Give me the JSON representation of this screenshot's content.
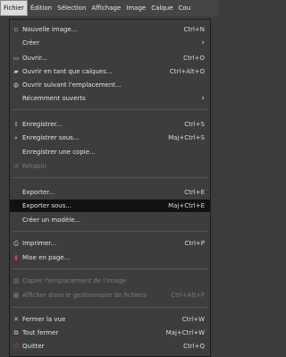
{
  "menubar": {
    "items": [
      "Fichier",
      "Édition",
      "Sélection",
      "Affichage",
      "Image",
      "Calque",
      "Cou"
    ]
  },
  "menu": {
    "items": [
      {
        "label": "Nouvelle image...",
        "shortcut": "Ctrl+N",
        "icon": "new-image-icon"
      },
      {
        "label": "Créer",
        "submenu": "›"
      },
      {
        "label": "Ouvrir...",
        "shortcut": "Ctrl+O",
        "icon": "open-icon"
      },
      {
        "label": "Ouvrir en tant que calques...",
        "shortcut": "Ctrl+Alt+O",
        "icon": "open-as-layers-icon"
      },
      {
        "label": "Ouvrir suivant l'emplacement...",
        "icon": "open-location-icon"
      },
      {
        "label": "Récemment ouverts",
        "submenu": "›"
      },
      {
        "label": "Enregistrer...",
        "shortcut": "Ctrl+S",
        "icon": "save-icon"
      },
      {
        "label": "Enregistrer sous...",
        "shortcut": "Maj+Ctrl+S",
        "icon": "save-as-icon"
      },
      {
        "label": "Enregistrer une copie..."
      },
      {
        "label": "Rétablir",
        "icon": "revert-icon",
        "disabled": true
      },
      {
        "label": "Exporter...",
        "shortcut": "Ctrl+E"
      },
      {
        "label": "Exporter sous...",
        "shortcut": "Maj+Ctrl+E",
        "highlighted": true
      },
      {
        "label": "Créer un modèle..."
      },
      {
        "label": "Imprimer...",
        "shortcut": "Ctrl+P",
        "icon": "print-icon"
      },
      {
        "label": "Mise en page...",
        "icon": "page-setup-icon"
      },
      {
        "label": "Copier l'emplacement de l'image",
        "icon": "copy-location-icon",
        "disabled": true
      },
      {
        "label": "Afficher dans le gestionnaire de fichiers",
        "shortcut": "Ctrl+Alt+F",
        "icon": "file-manager-icon",
        "disabled": true
      },
      {
        "label": "Fermer la vue",
        "shortcut": "Ctrl+W",
        "icon": "close-icon"
      },
      {
        "label": "Tout fermer",
        "shortcut": "Maj+Ctrl+W",
        "icon": "close-all-icon"
      },
      {
        "label": "Quitter",
        "shortcut": "Ctrl+Q",
        "icon": "quit-icon"
      }
    ]
  }
}
